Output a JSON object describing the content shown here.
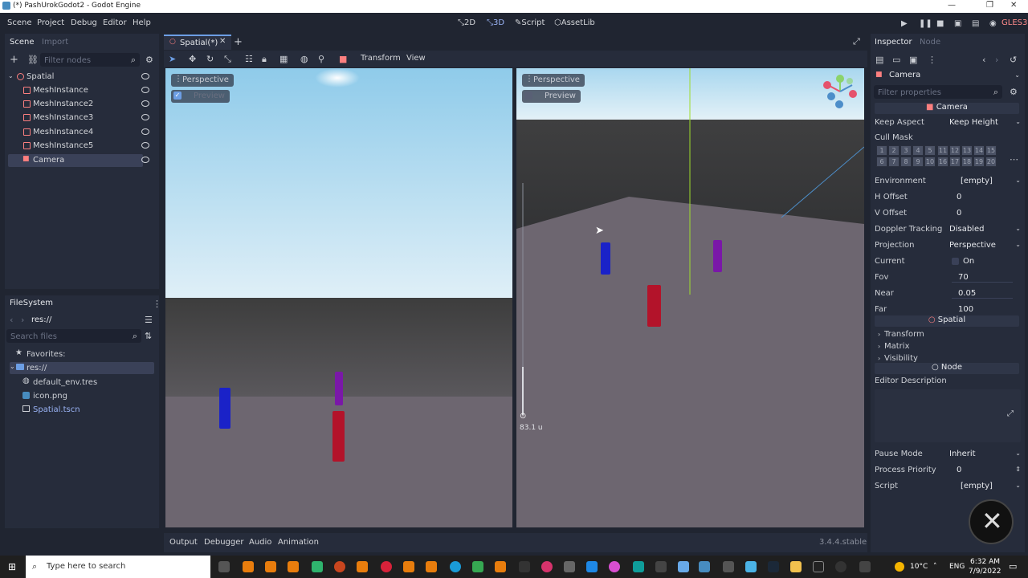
{
  "window": {
    "title": "(*) PashUrokGodot2 - Godot Engine"
  },
  "menu": {
    "items": [
      "Scene",
      "Project",
      "Debug",
      "Editor",
      "Help"
    ]
  },
  "workspaces": {
    "two_d": "2D",
    "three_d": "3D",
    "script": "Script",
    "assetlib": "AssetLib"
  },
  "renderer": "GLES3",
  "scene_dock": {
    "tab_scene": "Scene",
    "tab_import": "Import",
    "filter_placeholder": "Filter nodes",
    "nodes": [
      "Spatial",
      "MeshInstance",
      "MeshInstance2",
      "MeshInstance3",
      "MeshInstance4",
      "MeshInstance5",
      "Camera"
    ],
    "selected": "Camera"
  },
  "filesystem": {
    "title": "FileSystem",
    "path": "res://",
    "search_placeholder": "Search files",
    "favorites": "Favorites:",
    "items": [
      "res://",
      "default_env.tres",
      "icon.png",
      "Spatial.tscn"
    ]
  },
  "editor": {
    "tab_label": "Spatial(*)",
    "toolbar_transform": "Transform",
    "toolbar_view": "View",
    "left_viewport": {
      "perspective": "Perspective",
      "preview": "Preview"
    },
    "right_viewport": {
      "perspective": "Perspective",
      "preview": "Preview",
      "zoom_readout": "83.1 u"
    }
  },
  "bottom": {
    "tabs": [
      "Output",
      "Debugger",
      "Audio",
      "Animation"
    ],
    "version": "3.4.4.stable"
  },
  "inspector": {
    "tab_inspector": "Inspector",
    "tab_node": "Node",
    "object": "Camera",
    "filter_placeholder": "Filter properties",
    "section_camera": "Camera",
    "keep_aspect_label": "Keep Aspect",
    "keep_aspect_value": "Keep Height",
    "cull_mask_label": "Cull Mask",
    "cull_row1": [
      "1",
      "2",
      "3",
      "4",
      "5",
      "11",
      "12",
      "13",
      "14",
      "15"
    ],
    "cull_row2": [
      "6",
      "7",
      "8",
      "9",
      "10",
      "16",
      "17",
      "18",
      "19",
      "20"
    ],
    "environment_label": "Environment",
    "environment_value": "[empty]",
    "h_offset_label": "H Offset",
    "h_offset_value": "0",
    "v_offset_label": "V Offset",
    "v_offset_value": "0",
    "doppler_label": "Doppler Tracking",
    "doppler_value": "Disabled",
    "projection_label": "Projection",
    "projection_value": "Perspective",
    "current_label": "Current",
    "current_value": "On",
    "fov_label": "Fov",
    "fov_value": "70",
    "near_label": "Near",
    "near_value": "0.05",
    "far_label": "Far",
    "far_value": "100",
    "section_spatial": "Spatial",
    "transform": "Transform",
    "matrix": "Matrix",
    "visibility": "Visibility",
    "section_node": "Node",
    "editor_description": "Editor Description",
    "pause_mode_label": "Pause Mode",
    "pause_mode_value": "Inherit",
    "process_priority_label": "Process Priority",
    "process_priority_value": "0",
    "script_label": "Script",
    "script_value": "[empty]"
  },
  "taskbar": {
    "search_placeholder": "Type here to search",
    "temp": "10°C",
    "lang": "ENG",
    "time": "6:32 AM",
    "date": "7/9/2022"
  },
  "colors": {
    "accent": "#478cbf",
    "blue_box": "#1a22c8",
    "red_box": "#b3132a",
    "purple_box": "#7a18a8",
    "sky": "#bfe0f2",
    "ground": "#6d6670"
  }
}
